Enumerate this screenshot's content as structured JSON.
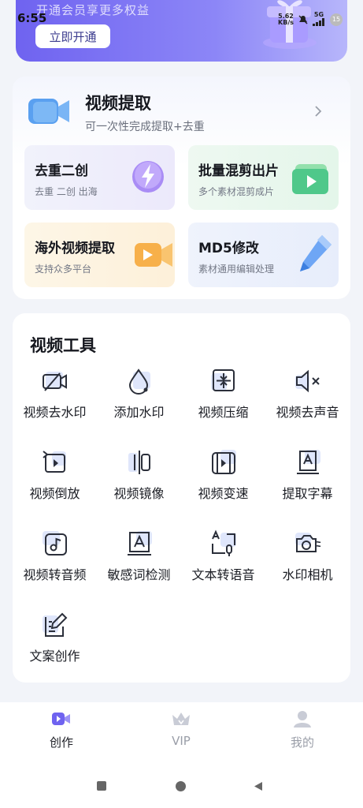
{
  "status_bar": {
    "time": "6:55",
    "speed_value": "5.62",
    "speed_unit": "KB/s",
    "network": "5G",
    "battery": "15"
  },
  "banner": {
    "subtitle": "开通会员享更多权益",
    "button_label": "立即开通"
  },
  "extract": {
    "title": "视频提取",
    "description": "可一次性完成提取+去重",
    "tiles": [
      {
        "title": "去重二创",
        "subtitle": "去重 二创 出海",
        "icon": "lightning-icon"
      },
      {
        "title": "批量混剪出片",
        "subtitle": "多个素材混剪成片",
        "icon": "play-folder-icon"
      },
      {
        "title": "海外视频提取",
        "subtitle": "支持众多平台",
        "icon": "video-camera-icon"
      },
      {
        "title": "MD5修改",
        "subtitle": "素材通用编辑处理",
        "icon": "pen-icon"
      }
    ]
  },
  "tools": {
    "title": "视频工具",
    "items": [
      {
        "label": "视频去水印",
        "icon": "video-no-watermark-icon"
      },
      {
        "label": "添加水印",
        "icon": "water-drop-icon"
      },
      {
        "label": "视频压缩",
        "icon": "compress-icon"
      },
      {
        "label": "视频去声音",
        "icon": "mute-icon"
      },
      {
        "label": "视频倒放",
        "icon": "reverse-icon"
      },
      {
        "label": "视频镜像",
        "icon": "mirror-icon"
      },
      {
        "label": "视频变速",
        "icon": "speed-icon"
      },
      {
        "label": "提取字幕",
        "icon": "subtitle-icon"
      },
      {
        "label": "视频转音频",
        "icon": "music-icon"
      },
      {
        "label": "敏感词检测",
        "icon": "text-detect-icon"
      },
      {
        "label": "文本转语音",
        "icon": "text-to-speech-icon"
      },
      {
        "label": "水印相机",
        "icon": "camera-icon"
      },
      {
        "label": "文案创作",
        "icon": "write-icon"
      }
    ]
  },
  "bottom_nav": {
    "items": [
      {
        "label": "创作",
        "icon": "create-icon",
        "active": true
      },
      {
        "label": "VIP",
        "icon": "crown-icon",
        "active": false
      },
      {
        "label": "我的",
        "icon": "profile-icon",
        "active": false
      }
    ]
  },
  "colors": {
    "accent": "#6f63f0",
    "tile_purple": "#ece9fb",
    "tile_green": "#e4f6ea",
    "tile_orange": "#fdf0d9",
    "tile_blue": "#e7edfb"
  }
}
